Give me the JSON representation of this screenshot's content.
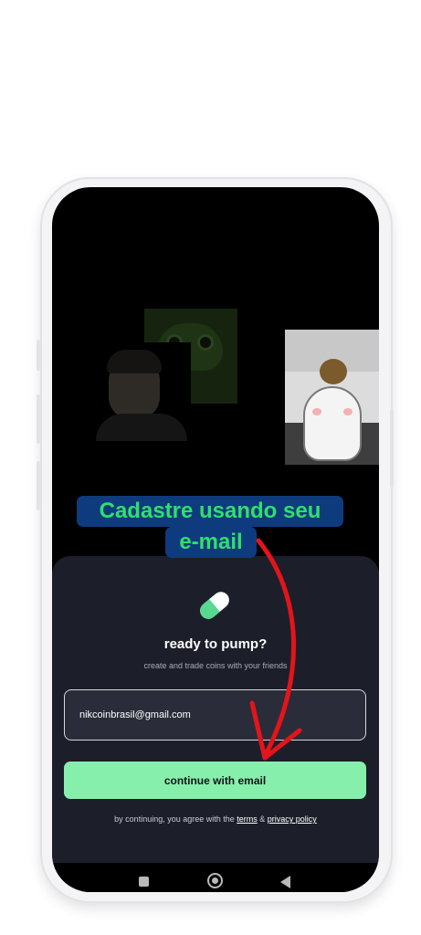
{
  "annotation": {
    "line1": "Cadastre usando seu",
    "line2": "e-mail",
    "text_color": "#2ee06c",
    "background_color": "#0e3b7d",
    "arrow_color": "#e3141b"
  },
  "sheet": {
    "icon": "pill-icon",
    "title": "ready to pump?",
    "subtitle": "create and trade coins with your friends"
  },
  "email_field": {
    "value": "nikcoinbrasil@gmail.com"
  },
  "continue_button": {
    "label": "continue with email",
    "color": "#86efac"
  },
  "legal": {
    "prefix": "by continuing, you agree with the ",
    "terms": "terms",
    "amp": " & ",
    "privacy": "privacy policy"
  },
  "navbar": {
    "recents_icon": "square-icon",
    "home_icon": "circle-home-icon",
    "back_icon": "triangle-back-icon"
  }
}
